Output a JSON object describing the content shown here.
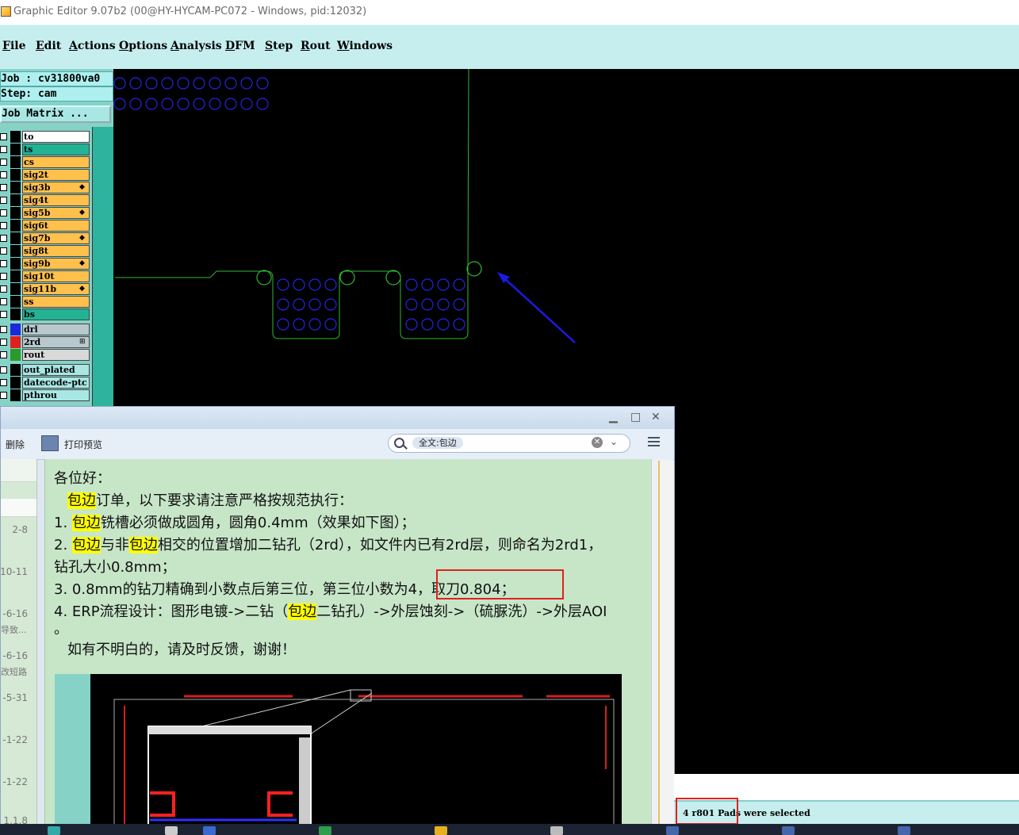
{
  "window": {
    "title": "Graphic Editor 9.07b2 (00@HY-HYCAM-PC072 - Windows, pid:12032)"
  },
  "menu": [
    "File",
    "Edit",
    "Actions",
    "Options",
    "Analysis",
    "DFM",
    "Step",
    "Rout",
    "Windows"
  ],
  "job_panel": {
    "job": "Job : cv31800va0",
    "step": "Step: cam",
    "matrix_button": "Job Matrix ..."
  },
  "layers": [
    {
      "name": "to",
      "color": "#ffffff"
    },
    {
      "name": "ts",
      "color": "#22b394"
    },
    {
      "name": "cs",
      "color": "#ffc04c"
    },
    {
      "name": "sig2t",
      "color": "#ffc04c"
    },
    {
      "name": "sig3b",
      "color": "#ffc04c",
      "mark": "◆"
    },
    {
      "name": "sig4t",
      "color": "#ffc04c"
    },
    {
      "name": "sig5b",
      "color": "#ffc04c",
      "mark": "◆"
    },
    {
      "name": "sig6t",
      "color": "#ffc04c"
    },
    {
      "name": "sig7b",
      "color": "#ffc04c",
      "mark": "◆"
    },
    {
      "name": "sig8t",
      "color": "#ffc04c"
    },
    {
      "name": "sig9b",
      "color": "#ffc04c",
      "mark": "◆"
    },
    {
      "name": "sig10t",
      "color": "#ffc04c"
    },
    {
      "name": "sig11b",
      "color": "#ffc04c",
      "mark": "◆"
    },
    {
      "name": "ss",
      "color": "#ffc04c"
    },
    {
      "name": "bs",
      "color": "#22b394"
    },
    {
      "name": "drl",
      "color": "#b9c8cf"
    },
    {
      "name": "2rd",
      "color": "#b9c8cf",
      "mark": "⊞"
    },
    {
      "name": "rout",
      "color": "#d9d9d9"
    },
    {
      "name": "out_plated",
      "color": "#a8e7e4"
    },
    {
      "name": "datecode-ptc",
      "color": "#a8e7e4"
    },
    {
      "name": "pthrou",
      "color": "#a8e7e4"
    }
  ],
  "mail": {
    "toolbar": {
      "delete": "删除",
      "print_preview": "打印预览"
    },
    "search": {
      "chip": "全文:包边"
    },
    "list_dates": [
      "2-8",
      "10-11",
      "-6-16",
      "-6-16",
      "-5-31",
      "-1-22",
      "-1-22",
      "1.1.8"
    ],
    "list_subs": [
      "导致...",
      "改短路"
    ],
    "body": {
      "greeting": "各位好：",
      "l1_hl": "包边",
      "l1_rest": "订单，以下要求请注意严格按规范执行：",
      "l2_pre": "1. ",
      "l2_hl": "包边",
      "l2_rest": "铣槽必须做成圆角，圆角0.4mm（效果如下图）；",
      "l3_pre": "2. ",
      "l3_hl": "包边",
      "l3_mid": "与非",
      "l3_hl2": "包边",
      "l3_rest": "相交的位置增加二钻孔（2rd），如文件内已有2rd层，则命名为2rd1，",
      "l4": "钻孔大小0.8mm；",
      "l5": "3. 0.8mm的钻刀精确到小数点后第三位，第三位小数为4，取刀0.804；",
      "l6_pre": "4. ERP流程设计：图形电镀->二钻（",
      "l6_hl": "包边",
      "l6_rest": "二钻孔）->外层蚀刻->（硫脲洗）->外层AOI",
      "l7": "。",
      "l8": "如有不明白的，请及时反馈，谢谢！"
    }
  },
  "status": {
    "message": "4 r801 Pads were selected"
  }
}
